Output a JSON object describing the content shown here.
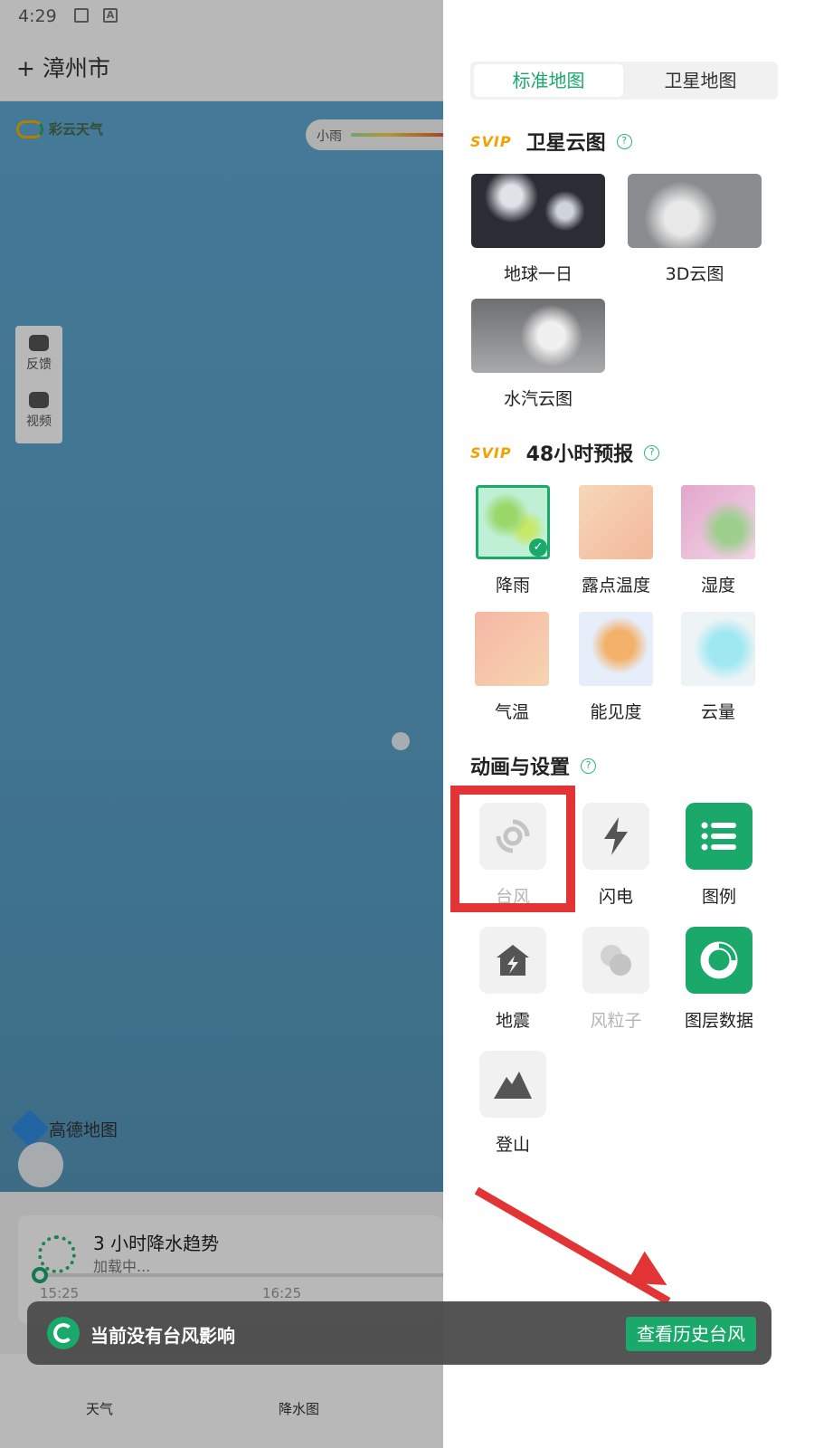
{
  "status": {
    "time": "4:29",
    "badge": "A"
  },
  "app": {
    "city_label": "+ 漳州市",
    "brand": "彩云天气",
    "rain_legend": "小雨"
  },
  "side_tools": [
    {
      "label": "反馈"
    },
    {
      "label": "视频"
    }
  ],
  "map_provider": "高德地图",
  "forecast_card": {
    "title": "3 小时降水趋势",
    "subtitle": "加载中...",
    "time_start": "15:25",
    "time_mid": "16:25"
  },
  "bottom_tabs": [
    {
      "label": "天气"
    },
    {
      "label": "降水图"
    }
  ],
  "drawer": {
    "map_tabs": [
      {
        "label": "标准地图",
        "active": true
      },
      {
        "label": "卫星地图",
        "active": false
      }
    ],
    "svip_badge": "SVIP",
    "satellite_section": {
      "title": "卫星云图",
      "items": [
        {
          "label": "地球一日"
        },
        {
          "label": "3D云图"
        },
        {
          "label": "水汽云图"
        }
      ]
    },
    "forecast_section": {
      "title": "48小时预报",
      "items": [
        {
          "label": "降雨",
          "selected": true
        },
        {
          "label": "露点温度"
        },
        {
          "label": "湿度"
        },
        {
          "label": "气温"
        },
        {
          "label": "能见度"
        },
        {
          "label": "云量"
        }
      ]
    },
    "settings_section": {
      "title": "动画与设置",
      "items": [
        {
          "label": "台风",
          "enabled": false
        },
        {
          "label": "闪电",
          "enabled": true
        },
        {
          "label": "图例",
          "enabled": true,
          "active": true
        },
        {
          "label": "地震",
          "enabled": true
        },
        {
          "label": "风粒子",
          "enabled": false
        },
        {
          "label": "图层数据",
          "enabled": true,
          "active": true
        },
        {
          "label": "登山",
          "enabled": true
        }
      ]
    }
  },
  "toast": {
    "message": "当前没有台风影响",
    "button": "查看历史台风"
  },
  "colors": {
    "accent": "#1aa96a",
    "svip": "#f2a200",
    "annotation": "#e23434"
  }
}
